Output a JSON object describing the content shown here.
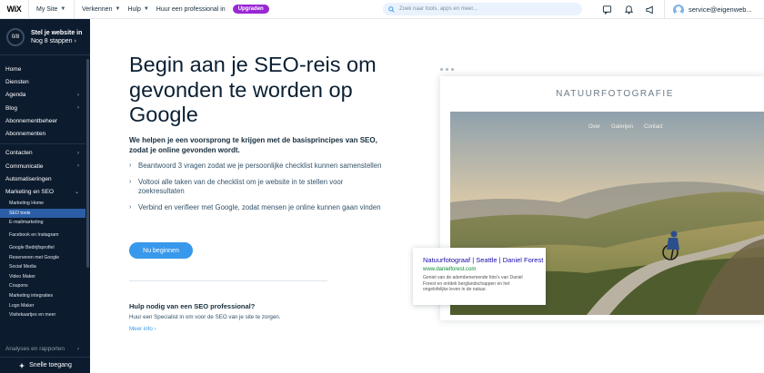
{
  "topbar": {
    "logo": "WiX",
    "site_selector": "My Site",
    "nav": [
      "Verkennen",
      "Hulp",
      "Huur een professional in"
    ],
    "upgrade_label": "Upgraden",
    "search_placeholder": "Zoek naar tools, apps en meer...",
    "account_email": "service@eigenweb..."
  },
  "sidebar": {
    "setup_progress": "0/8",
    "setup_title": "Stel je website in",
    "setup_sub": "Nog 8 stappen",
    "group1": [
      "Home",
      "Diensten"
    ],
    "group1_arrows": [
      {
        "label": "Agenda"
      },
      {
        "label": "Blog"
      }
    ],
    "group1_after": [
      "Abonnementbeheer",
      "Abonnementen"
    ],
    "group2": [
      {
        "label": "Contacten",
        "arrow": true
      },
      {
        "label": "Communicatie",
        "arrow": true
      },
      {
        "label": "Automatiseringen",
        "arrow": false
      }
    ],
    "marketing_label": "Marketing en SEO",
    "marketing_items": [
      "Marketing Home",
      "SEO tools",
      "E-mailmarketing",
      "Facebook en Instagram",
      "Google Bedrijfsprofiel",
      "Reserveren met Google",
      "Social Media",
      "Video Maker",
      "Coupons",
      "Marketing integraties",
      "Logo Maker",
      "Visitekaartjes en meer"
    ],
    "analyses_label": "Analyses en rapporten",
    "quick_access": "Snelle toegang"
  },
  "main": {
    "headline": "Begin aan je SEO-reis om gevonden te worden op Google",
    "lead": "We helpen je een voorsprong te krijgen met de basisprincipes van SEO, zodat je online gevonden wordt.",
    "checks": [
      "Beantwoord 3 vragen zodat we je persoonlijke checklist kunnen samenstellen",
      "Voltooi alle taken van de checklist om je website in te stellen voor zoekresultaten",
      "Verbind en verifieer met Google, zodat mensen je online kunnen gaan vinden"
    ],
    "cta_label": "Nu beginnen",
    "help_title": "Hulp nodig van een SEO professional?",
    "help_text": "Huur een Specialist in om voor de SEO van je site te zorgen.",
    "more_link": "Meer info"
  },
  "preview": {
    "site_title": "NATUURFOTOGRAFIE",
    "nav": [
      "Over",
      "Galerijen",
      "Contact"
    ],
    "result_title": "Natuurfotograaf | Seattle | Daniel Forest",
    "result_url": "www.danielforest.com",
    "result_desc": "Geniet van de adembenemende foto's van Daniel Forest en ontdek berglandschappen en het ongelofelijke leven in de natuur."
  },
  "colors": {
    "accent": "#3899ec",
    "upgrade": "#9a27d5",
    "sidebar_bg": "#0c1b2e",
    "sidebar_active": "#2b5ea7"
  }
}
